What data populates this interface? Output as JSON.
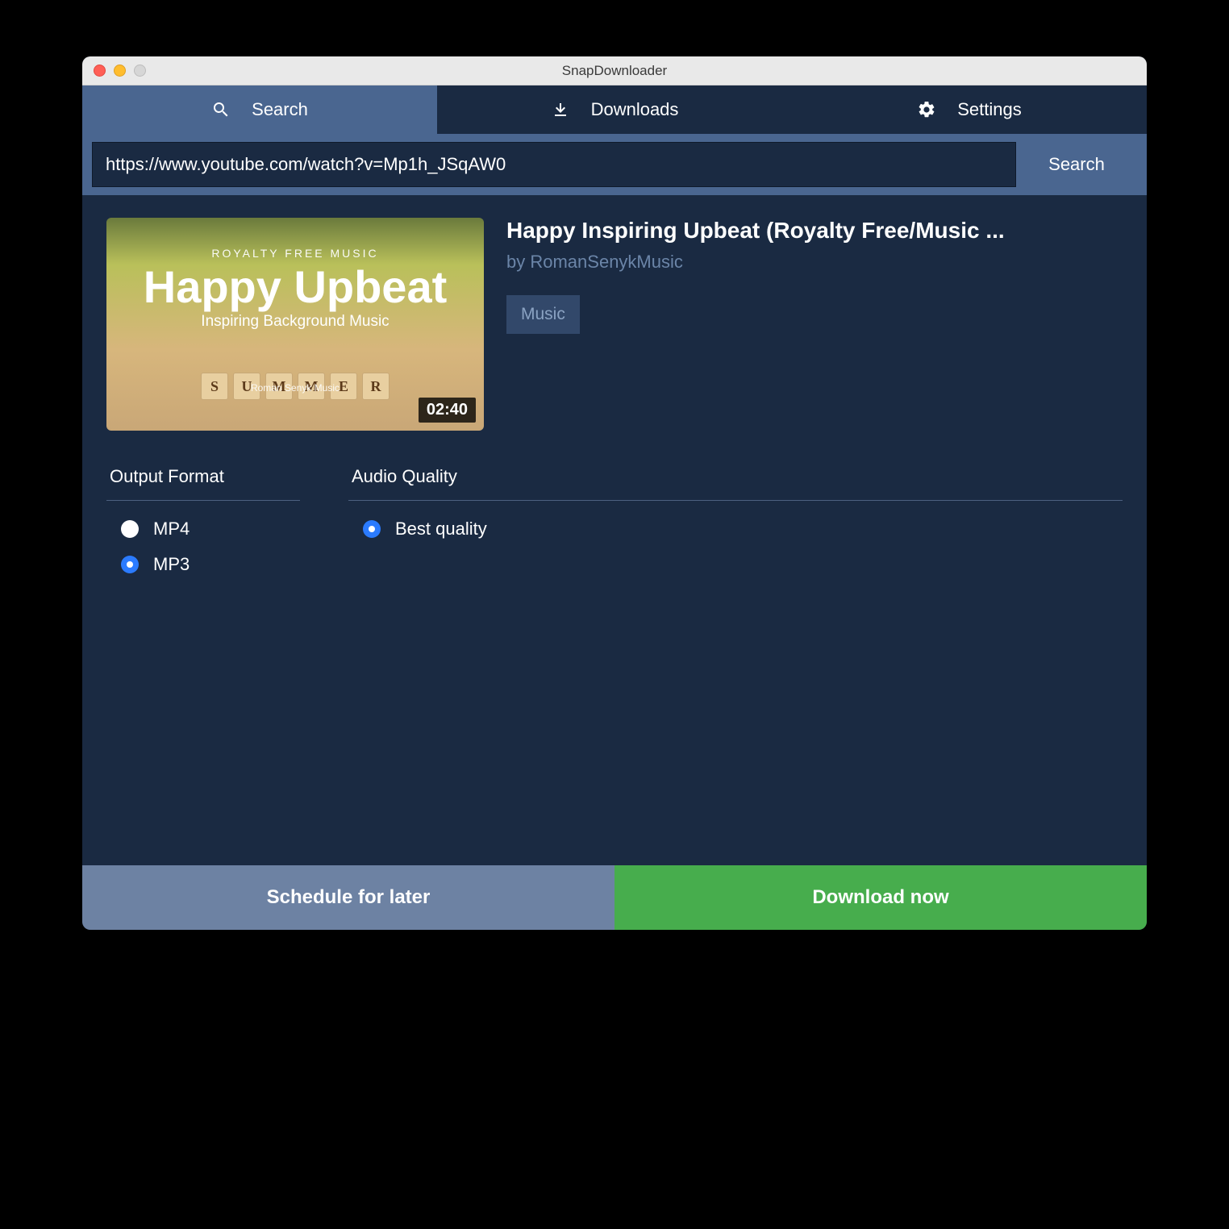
{
  "window": {
    "title": "SnapDownloader"
  },
  "tabs": {
    "search": "Search",
    "downloads": "Downloads",
    "settings": "Settings"
  },
  "searchbar": {
    "url": "https://www.youtube.com/watch?v=Mp1h_JSqAW0",
    "button": "Search"
  },
  "video": {
    "title": "Happy Inspiring Upbeat (Royalty Free/Music ...",
    "author_prefix": "by ",
    "author": "RomanSenykMusic",
    "tag": "Music",
    "duration": "02:40",
    "thumb": {
      "top": "ROYALTY FREE MUSIC",
      "big": "Happy Upbeat",
      "sub": "Inspiring Background Music",
      "credit": "Roman Senyk Music",
      "letters": [
        "S",
        "U",
        "M",
        "M",
        "E",
        "R"
      ]
    }
  },
  "options": {
    "format_label": "Output Format",
    "quality_label": "Audio Quality",
    "formats": [
      {
        "label": "MP4",
        "checked": false
      },
      {
        "label": "MP3",
        "checked": true
      }
    ],
    "qualities": [
      {
        "label": "Best quality",
        "checked": true
      }
    ]
  },
  "footer": {
    "schedule": "Schedule for later",
    "download": "Download now"
  }
}
